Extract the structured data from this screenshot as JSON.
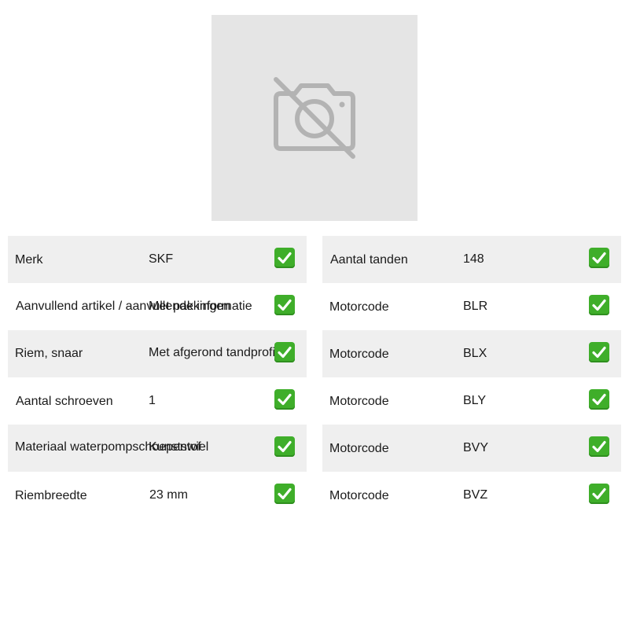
{
  "product_image": {
    "icon": "camera-off-icon"
  },
  "check_icon": "check-icon",
  "colors": {
    "check_green": "#3fae2a",
    "row_shade": "#efefef",
    "placeholder_bg": "#e5e5e5"
  },
  "left_table": [
    {
      "label": "Merk",
      "value": "SKF"
    },
    {
      "label": "Aanvullend artikel / aanvullende informatie",
      "value": "Met pakkingen"
    },
    {
      "label": "Riem, snaar",
      "value": "Met afgerond tandprofiel"
    },
    {
      "label": "Aantal schroeven",
      "value": "1"
    },
    {
      "label": "Materiaal waterpompschoepenwiel",
      "value": "Kunststof"
    },
    {
      "label": "Riembreedte",
      "value": "23 mm"
    }
  ],
  "right_table": [
    {
      "label": "Aantal tanden",
      "value": "148"
    },
    {
      "label": "Motorcode",
      "value": "BLR"
    },
    {
      "label": "Motorcode",
      "value": "BLX"
    },
    {
      "label": "Motorcode",
      "value": "BLY"
    },
    {
      "label": "Motorcode",
      "value": "BVY"
    },
    {
      "label": "Motorcode",
      "value": "BVZ"
    }
  ]
}
